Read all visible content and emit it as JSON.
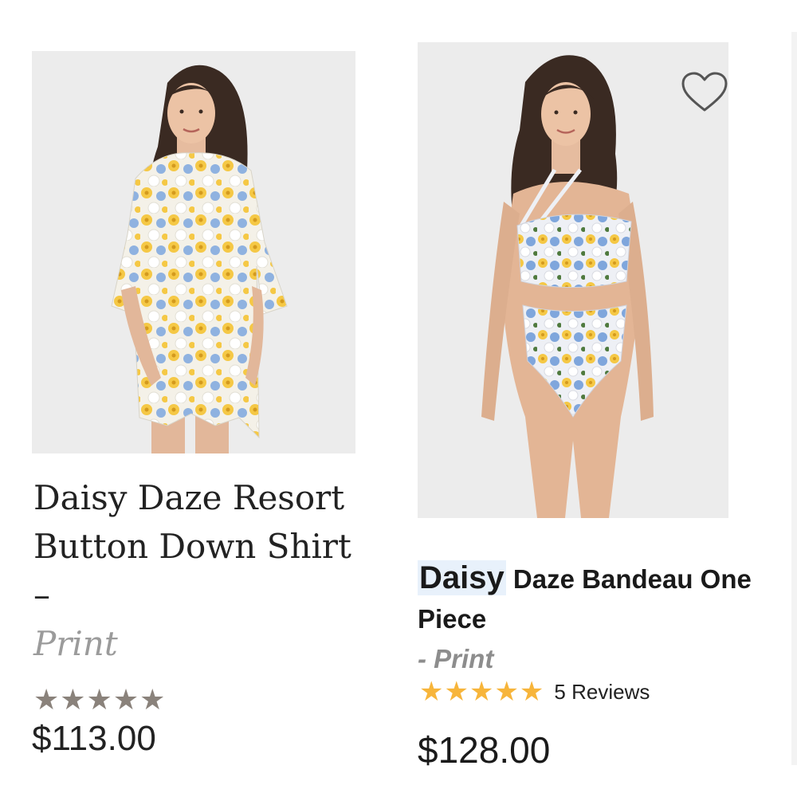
{
  "products": [
    {
      "title": "Daisy Daze Resort Button Down Shirt –",
      "variant": "Print",
      "stars": "★★★★★",
      "price": "$113.00",
      "image_alt": "Model wearing Daisy Daze Resort Button Down Shirt",
      "rating_color": "#8a827b"
    },
    {
      "title_highlight": "Daisy",
      "title": "Daze Bandeau One Piece",
      "variant": "- Print",
      "stars": "★★★★★",
      "reviews": "5 Reviews",
      "price": "$128.00",
      "image_alt": "Model wearing Daisy Daze Bandeau One Piece",
      "rating_color": "#f7b53b",
      "wishlist_icon": "heart-outline-icon"
    }
  ],
  "colors": {
    "highlight": "#e8f1fb",
    "variant_text": "#9b9b9b",
    "image_bg": "#ececec"
  }
}
